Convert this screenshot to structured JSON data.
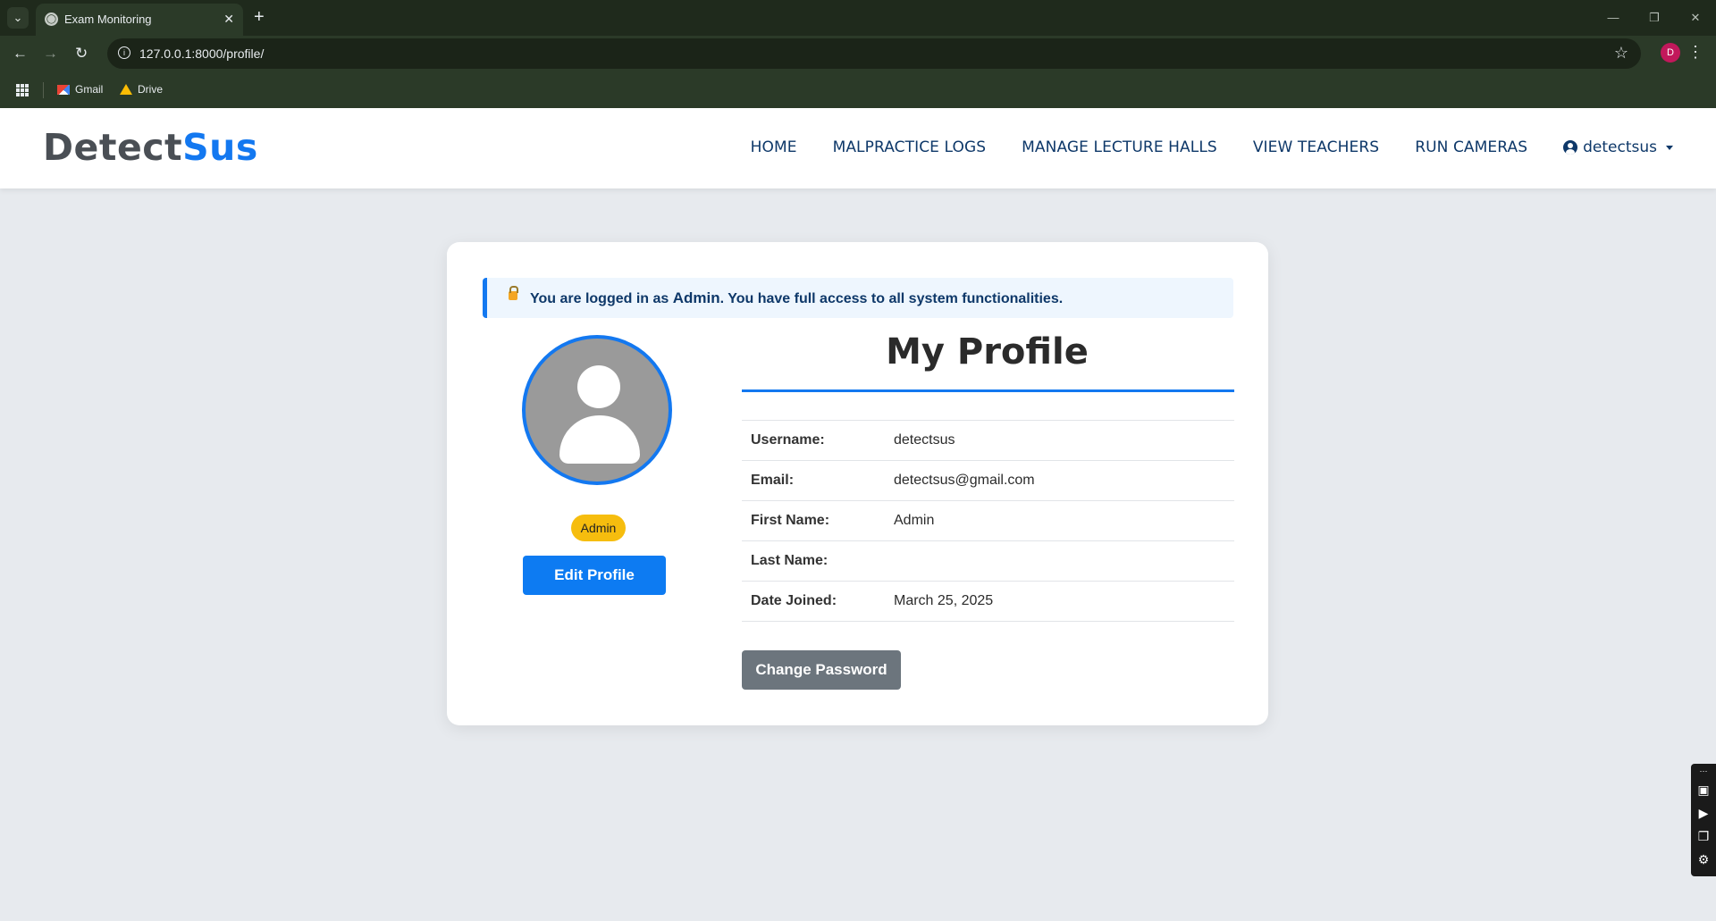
{
  "browser": {
    "tab_title": "Exam Monitoring",
    "url": "127.0.0.1:8000/profile/",
    "profile_initial": "D",
    "bookmarks": [
      {
        "label": "Gmail",
        "icon": "gmail-icon"
      },
      {
        "label": "Drive",
        "icon": "drive-icon"
      }
    ]
  },
  "navbar": {
    "brand_part1": "Detect",
    "brand_part2": "Sus",
    "brand_color": "#1378f0",
    "items": [
      "HOME",
      "MALPRACTICE LOGS",
      "MANAGE LECTURE HALLS",
      "VIEW TEACHERS",
      "RUN CAMERAS"
    ],
    "user": "detectsus"
  },
  "alert": {
    "prefix": "You are logged in as ",
    "role": "Admin",
    "suffix": ". You have full access to all system functionalities."
  },
  "profile": {
    "title": "My Profile",
    "role_badge": "Admin",
    "edit_button": "Edit Profile",
    "change_password_button": "Change Password",
    "fields": [
      {
        "label": "Username:",
        "value": "detectsus"
      },
      {
        "label": "Email:",
        "value": "detectsus@gmail.com"
      },
      {
        "label": "First Name:",
        "value": "Admin"
      },
      {
        "label": "Last Name:",
        "value": ""
      },
      {
        "label": "Date Joined:",
        "value": "March 25, 2025"
      }
    ]
  },
  "colors": {
    "primary": "#0d7bf2",
    "badge": "#f6bd0e",
    "secondary_button": "#6c757d",
    "chrome_bg": "#2b3a28"
  }
}
